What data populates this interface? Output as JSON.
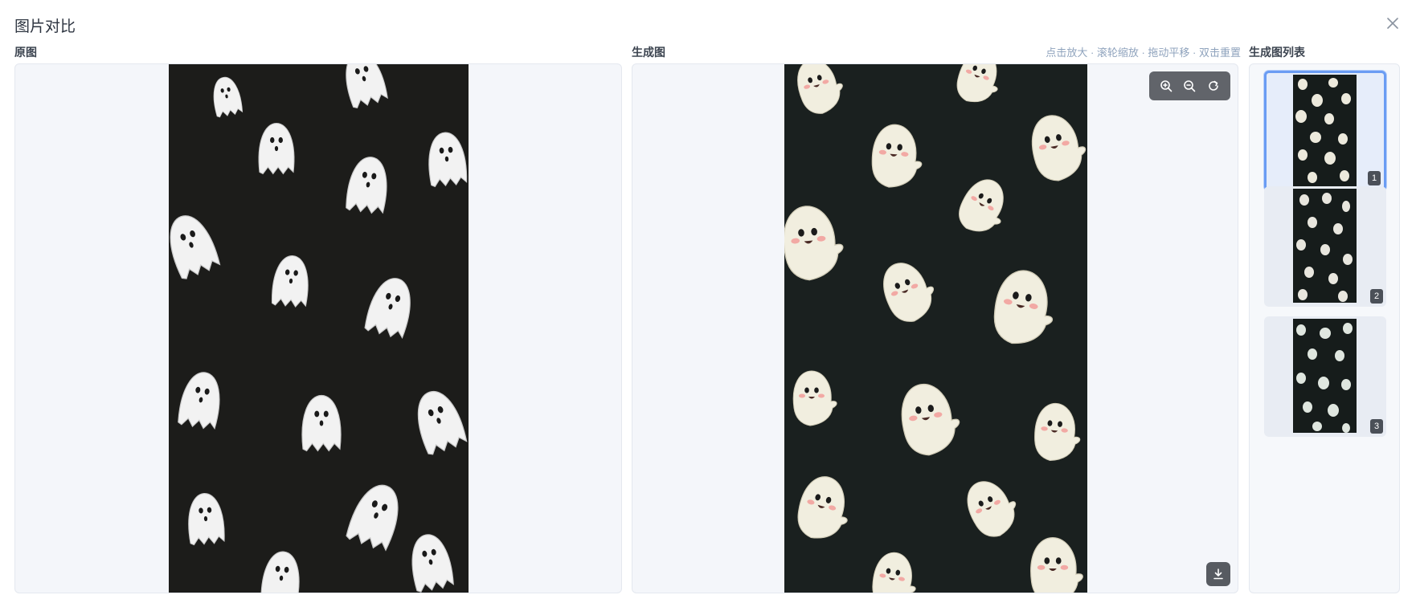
{
  "dialog": {
    "title": "图片对比",
    "close_icon": "close-icon"
  },
  "original": {
    "label": "原图"
  },
  "generated": {
    "label": "生成图",
    "hint": "点击放大 · 滚轮缩放 · 拖动平移 · 双击重置",
    "zoom_in_icon": "zoom-in-icon",
    "zoom_out_icon": "zoom-out-icon",
    "reset_icon": "reset-icon",
    "download_icon": "download-icon"
  },
  "list": {
    "label": "生成图列表",
    "items": [
      {
        "badge": "1",
        "selected": true
      },
      {
        "badge": "2",
        "selected": false
      },
      {
        "badge": "3",
        "selected": false
      }
    ]
  },
  "colors": {
    "accent": "#6a9cf3",
    "hint": "#8fa3bd",
    "panel_bg": "#f4f6fa",
    "original_bg": "#1c1c1a",
    "generated_bg": "#1a201f",
    "ghost_original": "#f2f2f2",
    "ghost_generated": "#f1eedf",
    "blush": "#f2a9a4"
  }
}
